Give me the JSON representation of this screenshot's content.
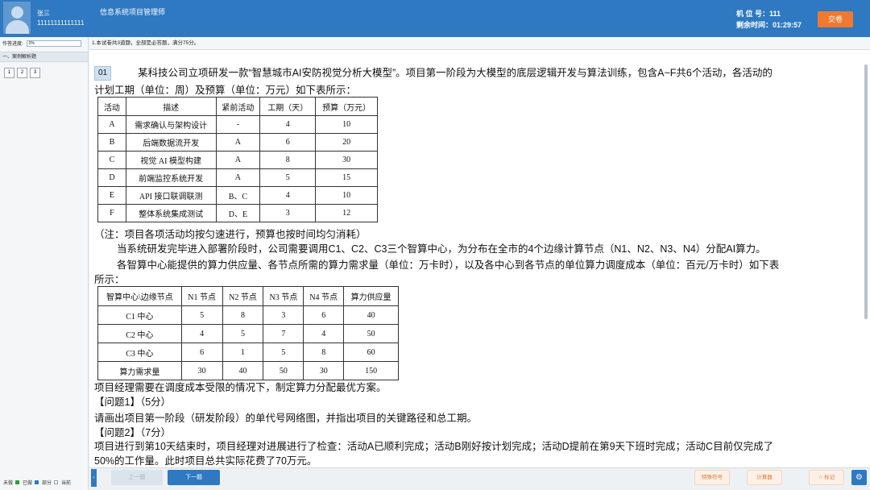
{
  "header": {
    "user_name": "张三",
    "user_id": "11111111111111",
    "exam_title": "信息系统项目管理师",
    "seat_label": "机 位 号：111",
    "time_label": "剩余时间：01:29:57",
    "submit": "交卷"
  },
  "left": {
    "progress_label": "作答进度:",
    "progress_value": "0%",
    "section": "一、案例解析题",
    "questions": [
      "1",
      "2",
      "3"
    ],
    "legend": {
      "unanswered": "未做",
      "answered": "已做",
      "partial": "部分",
      "current": "当前"
    }
  },
  "notice": "1.本试卷共3道题，全部是必答题，满分75分。",
  "question": {
    "number": "01",
    "intro_1": "某科技公司立项研发一款“智慧城市AI安防视觉分析大模型”。项目第一阶段为大模型的底层逻辑开发与算法训练，包含A~F共6个活动，各活动的",
    "intro_2": "计划工期（单位：周）及预算（单位：万元）如下表所示：",
    "table1": {
      "headers": [
        "活动",
        "描述",
        "紧前活动",
        "工期（天）",
        "预算（万元）"
      ],
      "rows": [
        [
          "A",
          "需求确认与架构设计",
          "-",
          "4",
          "10"
        ],
        [
          "B",
          "后端数据流开发",
          "A",
          "6",
          "20"
        ],
        [
          "C",
          "视觉 AI 模型构建",
          "A",
          "8",
          "30"
        ],
        [
          "D",
          "前端监控系统开发",
          "A",
          "5",
          "15"
        ],
        [
          "E",
          "API 接口联调联测",
          "B、C",
          "4",
          "10"
        ],
        [
          "F",
          "整体系统集成测试",
          "D、E",
          "3",
          "12"
        ]
      ]
    },
    "note": "（注：项目各项活动均按匀速进行，预算也按时间均匀消耗）",
    "para2": "当系统研发完毕进入部署阶段时，公司需要调用C1、C2、C3三个智算中心，为分布在全市的4个边缘计算节点（N1、N2、N3、N4）分配AI算力。",
    "para3_1": "各智算中心能提供的算力供应量、各节点所需的算力需求量（单位：万卡时），以及各中心到各节点的单位算力调度成本（单位：百元/万卡时）如下表",
    "para3_2": "所示：",
    "table2": {
      "headers": [
        "智算中心\\边缘节点",
        "N1 节点",
        "N2 节点",
        "N3 节点",
        "N4 节点",
        "算力供应量"
      ],
      "rows": [
        [
          "C1 中心",
          "5",
          "8",
          "3",
          "6",
          "40"
        ],
        [
          "C2 中心",
          "4",
          "5",
          "7",
          "4",
          "50"
        ],
        [
          "C3 中心",
          "6",
          "1",
          "5",
          "8",
          "60"
        ],
        [
          "算力需求量",
          "30",
          "40",
          "50",
          "30",
          "150"
        ]
      ]
    },
    "para4": "项目经理需要在调度成本受限的情况下，制定算力分配最优方案。",
    "q1_title": "【问题1】（5分）",
    "q1_text": "请画出项目第一阶段（研发阶段）的单代号网络图，并指出项目的关键路径和总工期。",
    "q2_title": "【问题2】（7分）",
    "q2_text": "项目进行到第10天结束时，项目经理对进展进行了检查：活动A已顺利完成；活动B刚好按计划完成；活动D提前在第9天下班时完成；活动C目前仅完成了",
    "q2_text2": "50%的工作量。此时项目总共实际花费了70万元。"
  },
  "bottom": {
    "collapse": "‹",
    "prev": "上一题",
    "next": "下一题",
    "special": "特殊符号",
    "calculator": "计算器",
    "mark": "☆ 标记",
    "settings": "⚙"
  },
  "colors": {
    "brand": "#2e79c1",
    "submit": "#f0792f",
    "legend_answered": "#2e9a3e",
    "legend_partial": "#2e79c1"
  }
}
